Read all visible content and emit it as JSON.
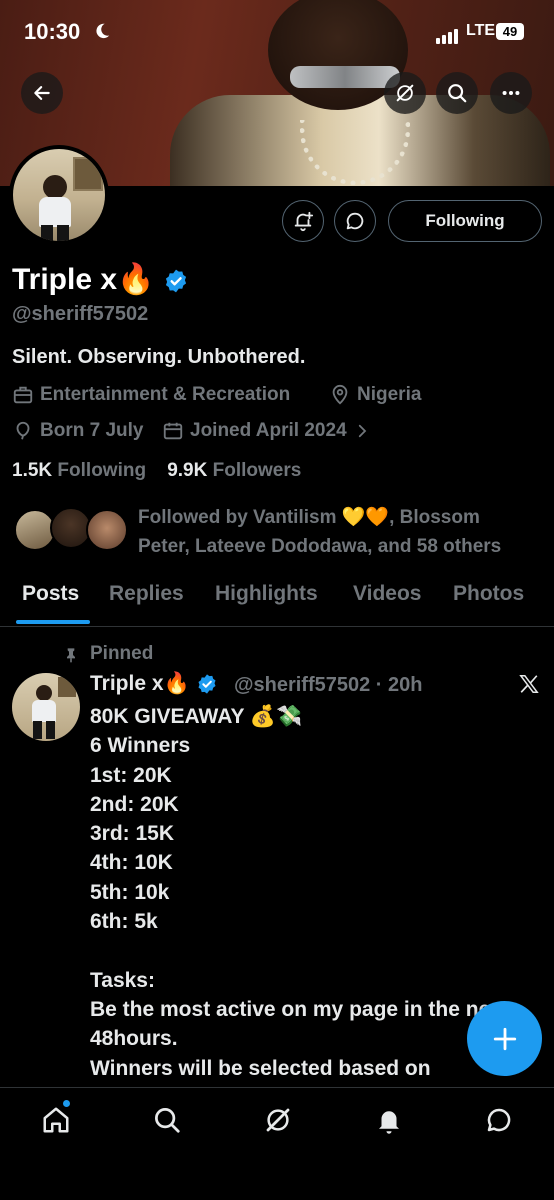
{
  "status_bar": {
    "time": "10:30",
    "network": "LTE",
    "battery": "49"
  },
  "profile": {
    "display_name": "Triple x🔥",
    "handle": "@sheriff57502",
    "bio": "Silent. Observing. Unbothered.",
    "category": "Entertainment & Recreation",
    "location": "Nigeria",
    "birthday": "Born 7 July",
    "joined": "Joined April 2024",
    "following_count": "1.5K",
    "following_label": "Following",
    "followers_count": "9.9K",
    "followers_label": "Followers",
    "followed_by_line1": "Followed by Vantilism 💛🧡, Blossom",
    "followed_by_line2": "Peter, Lateeve Dododawa, and 58 others"
  },
  "actions": {
    "following_button": "Following"
  },
  "tabs": [
    {
      "label": "Posts",
      "active": true
    },
    {
      "label": "Replies",
      "active": false
    },
    {
      "label": "Highlights",
      "active": false
    },
    {
      "label": "Videos",
      "active": false
    },
    {
      "label": "Photos",
      "active": false
    }
  ],
  "pinned_post": {
    "pinned_label": "Pinned",
    "author": "Triple x🔥",
    "handle_time": "@sheriff57502 · 20h",
    "text": "80K GIVEAWAY 💰💸\n6 Winners\n1st: 20K\n2nd: 20K\n3rd: 15K\n4th: 10K\n5th: 10k\n6th: 5k\n\nTasks:\nBe the most active on my page in the next 48hours.\nWinners will be selected based on highest engagement, will"
  },
  "colors": {
    "accent": "#1d9bf0",
    "background": "#000000",
    "muted": "#71767b",
    "text": "#e7e9ea"
  },
  "icons": {
    "back": "arrow-left-icon",
    "grok": "grok-icon",
    "search": "search-icon",
    "more": "more-dots-icon",
    "notify": "bell-plus-icon",
    "message": "chat-bubble-icon",
    "nav": [
      "home-icon",
      "search-icon",
      "grok-icon",
      "bell-icon",
      "chat-bubble-icon"
    ]
  }
}
